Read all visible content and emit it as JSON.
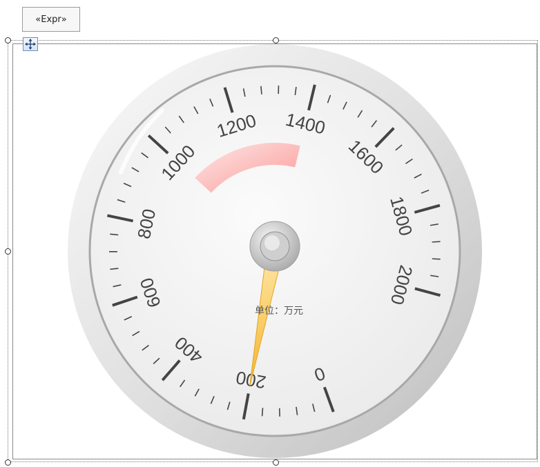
{
  "expr_tag": "«Expr»",
  "gauge": {
    "unit_label": "单位：万元",
    "min": 0,
    "max": 2000,
    "value": 200,
    "major_ticks": [
      "0",
      "200",
      "400",
      "600",
      "800",
      "1000",
      "1200",
      "1400",
      "1600",
      "1800",
      "2000"
    ],
    "alert_range": {
      "from": 1000,
      "to": 1400,
      "color": "#ff8a86"
    },
    "needle_color": "#f7c043",
    "face_color": "#f4f4f4",
    "bezel_color": "#d9d9d9"
  }
}
